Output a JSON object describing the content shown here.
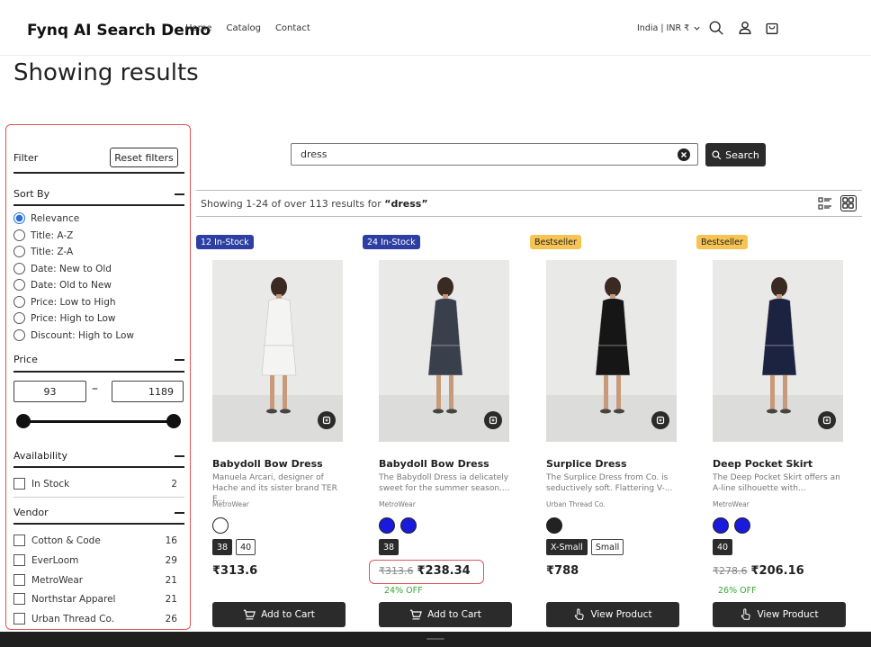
{
  "header": {
    "brand": "Fynq AI Search Demo",
    "nav": [
      "Home",
      "Catalog",
      "Contact"
    ],
    "currency": "India | INR ₹"
  },
  "page_title": "Showing results",
  "filter": {
    "title": "Filter",
    "reset_label": "Reset filters",
    "sort_by": {
      "title": "Sort By",
      "options": [
        "Relevance",
        "Title: A-Z",
        "Title: Z-A",
        "Date: New to Old",
        "Date: Old to New",
        "Price: Low to High",
        "Price: High to Low",
        "Discount: High to Low"
      ],
      "selected": "Relevance"
    },
    "price": {
      "title": "Price",
      "min": "93",
      "max": "1189",
      "separator": "–"
    },
    "availability": {
      "title": "Availability",
      "items": [
        {
          "label": "In Stock",
          "count": "2"
        }
      ]
    },
    "vendor": {
      "title": "Vendor",
      "items": [
        {
          "label": "Cotton & Code",
          "count": "16"
        },
        {
          "label": "EverLoom",
          "count": "29"
        },
        {
          "label": "MetroWear",
          "count": "21"
        },
        {
          "label": "Northstar Apparel",
          "count": "21"
        },
        {
          "label": "Urban Thread Co.",
          "count": "26"
        }
      ]
    }
  },
  "search": {
    "value": "dress",
    "button_label": "Search"
  },
  "results": {
    "prefix": "Showing 1-24 of over 113 results for ",
    "query": "“dress”"
  },
  "products": [
    {
      "badge": "12 In-Stock",
      "badge_style": "blue",
      "name": "Babydoll Bow Dress",
      "desc": "Manuela Arcari, designer of Hache and its sister brand TER E...",
      "vendor": "MetroWear",
      "swatches": [
        "#ffffff"
      ],
      "sizes": [
        "38",
        "40"
      ],
      "price": "₹313.6",
      "old_price": "",
      "off": "",
      "button": "Add to Cart",
      "button_icon": "cart-icon",
      "dress_color": "#f4f4f2"
    },
    {
      "badge": "24 In-Stock",
      "badge_style": "blue",
      "name": "Babydoll Bow Dress",
      "desc": "The Babydoll Dress ia delicately sweet for the summer season....",
      "vendor": "MetroWear",
      "swatches": [
        "#1a1adc",
        "#1a1adc"
      ],
      "sizes": [
        "38"
      ],
      "price": "₹238.34",
      "old_price": "₹313.6",
      "off": "24% OFF",
      "button": "Add to Cart",
      "button_icon": "cart-icon",
      "dress_color": "#3a3f4c"
    },
    {
      "badge": "Bestseller",
      "badge_style": "gold",
      "name": "Surplice Dress",
      "desc": "The Surplice Dress from Co. is seductively soft. Flattering V-...",
      "vendor": "Urban Thread Co.",
      "swatches": [
        "#222222"
      ],
      "sizes": [
        "X-Small",
        "Small"
      ],
      "price": "₹788",
      "old_price": "",
      "off": "",
      "button": "View Product",
      "button_icon": "pointer-icon",
      "dress_color": "#161616"
    },
    {
      "badge": "Bestseller",
      "badge_style": "gold",
      "name": "Deep Pocket Skirt",
      "desc": "The Deep Pocket Skirt offers an A-line silhouette with...",
      "vendor": "MetroWear",
      "swatches": [
        "#1a1adc",
        "#1a1adc"
      ],
      "sizes": [
        "40"
      ],
      "price": "₹206.16",
      "old_price": "₹278.6",
      "off": "26% OFF",
      "button": "View Product",
      "button_icon": "pointer-icon",
      "dress_color": "#1c2340"
    }
  ],
  "colors": {
    "accent_dark": "#2b2b2b",
    "badge_blue": "#2d3fa3",
    "badge_gold": "#f6c453",
    "discount_green": "#3aa63a",
    "highlight_red": "#e05555"
  }
}
